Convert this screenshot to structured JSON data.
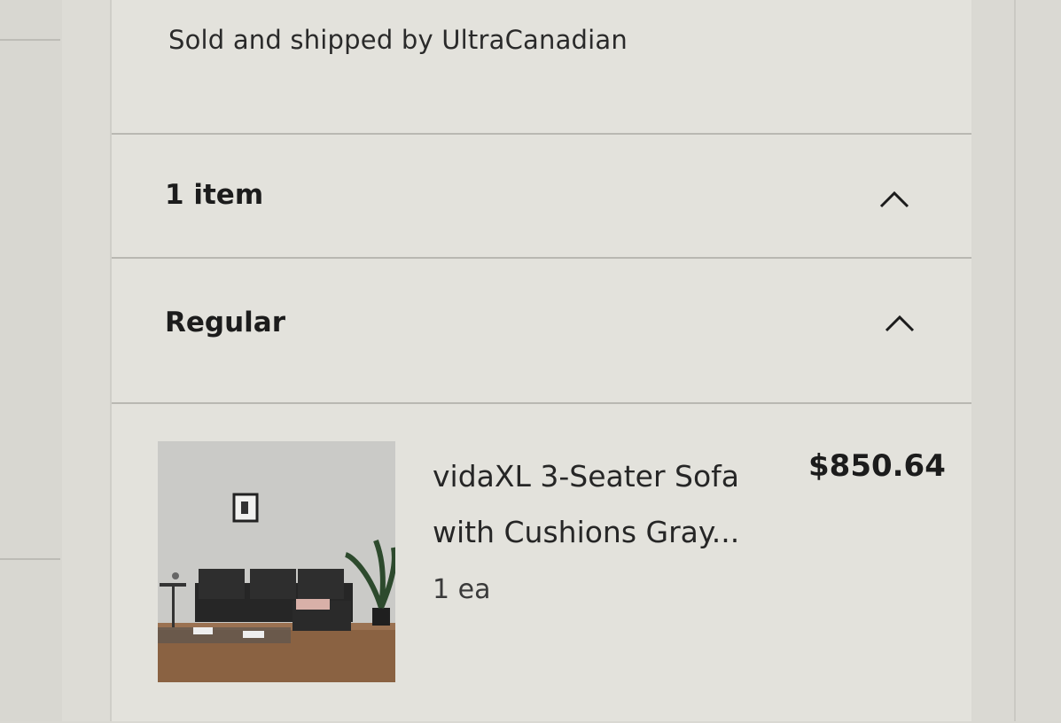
{
  "seller": {
    "text": "Sold and shipped by UltraCanadian"
  },
  "items_section": {
    "label": "1 item",
    "toggle_icon": "chevron-up-icon"
  },
  "shipping_section": {
    "label": "Regular",
    "toggle_icon": "chevron-up-icon"
  },
  "cart_item": {
    "title": "vidaXL 3-Seater Sofa with Cushions Gray...",
    "quantity": "1 ea",
    "price": "$850.64",
    "image": "sofa-product-photo"
  },
  "colors": {
    "page_bg": "#d9d8d2",
    "panel_bg": "#e3e2dc",
    "text": "#222222",
    "divider": "#b9b8b2"
  }
}
